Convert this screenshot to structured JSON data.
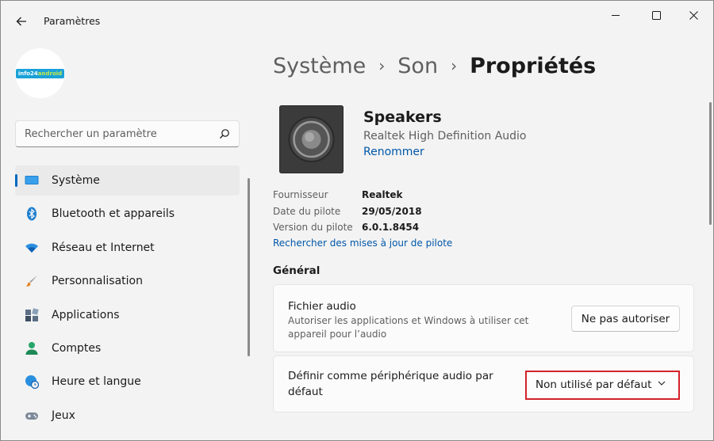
{
  "titlebar": {
    "app_title": "Paramètres"
  },
  "avatar": {
    "logo_text_a": "info24",
    "logo_text_b": "android"
  },
  "search": {
    "placeholder": "Rechercher un paramètre"
  },
  "sidebar": {
    "items": [
      {
        "label": "Système",
        "icon": "monitor-icon",
        "selected": true
      },
      {
        "label": "Bluetooth et appareils",
        "icon": "bluetooth-icon"
      },
      {
        "label": "Réseau et Internet",
        "icon": "wifi-icon"
      },
      {
        "label": "Personnalisation",
        "icon": "brush-icon"
      },
      {
        "label": "Applications",
        "icon": "apps-icon"
      },
      {
        "label": "Comptes",
        "icon": "person-icon"
      },
      {
        "label": "Heure et langue",
        "icon": "globe-clock-icon"
      },
      {
        "label": "Jeux",
        "icon": "gamepad-icon"
      }
    ]
  },
  "breadcrumb": {
    "level1": "Système",
    "level2": "Son",
    "current": "Propriétés"
  },
  "device": {
    "name": "Speakers",
    "subtitle": "Realtek High Definition Audio",
    "rename": "Renommer"
  },
  "properties": [
    {
      "key": "Fournisseur",
      "value": "Realtek"
    },
    {
      "key": "Date du pilote",
      "value": "29/05/2018"
    },
    {
      "key": "Version du pilote",
      "value": "6.0.1.8454"
    }
  ],
  "driver_update_link": "Rechercher des mises à jour de pilote",
  "general": {
    "title": "Général",
    "audio_file": {
      "title": "Fichier audio",
      "desc": "Autoriser les applications et Windows à utiliser cet appareil pour l’audio",
      "button": "Ne pas autoriser"
    },
    "default_device": {
      "title_line1": "Définir comme périphérique audio par",
      "title_line2": "défaut",
      "dropdown_value": "Non utilisé par défaut"
    }
  },
  "colors": {
    "accent": "#0067c0",
    "highlight_border": "#d3222a"
  }
}
